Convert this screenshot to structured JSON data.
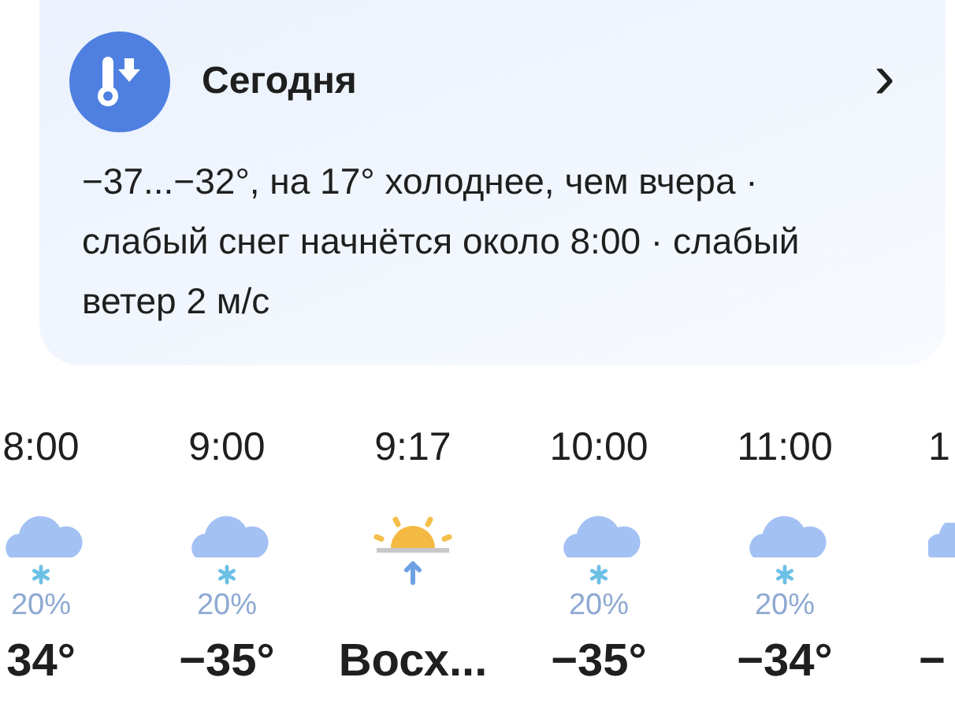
{
  "today_card": {
    "title": "Сегодня",
    "chevron": "›",
    "summary": "−37...−32°, на 17° холоднее, чем вчера · слабый снег начнётся около 8:00 · слабый ветер 2 м/с"
  },
  "hourly": [
    {
      "kind": "snow",
      "time": "8:00",
      "precipitation": "20%",
      "temperature": "34°"
    },
    {
      "kind": "snow",
      "time": "9:00",
      "precipitation": "20%",
      "temperature": "−35°"
    },
    {
      "kind": "sunrise",
      "time": "9:17",
      "temperature": "Восх..."
    },
    {
      "kind": "snow",
      "time": "10:00",
      "precipitation": "20%",
      "temperature": "−35°"
    },
    {
      "kind": "snow",
      "time": "11:00",
      "precipitation": "20%",
      "temperature": "−34°"
    },
    {
      "kind": "snow_cut",
      "time": "1",
      "temperature": "−"
    }
  ]
}
